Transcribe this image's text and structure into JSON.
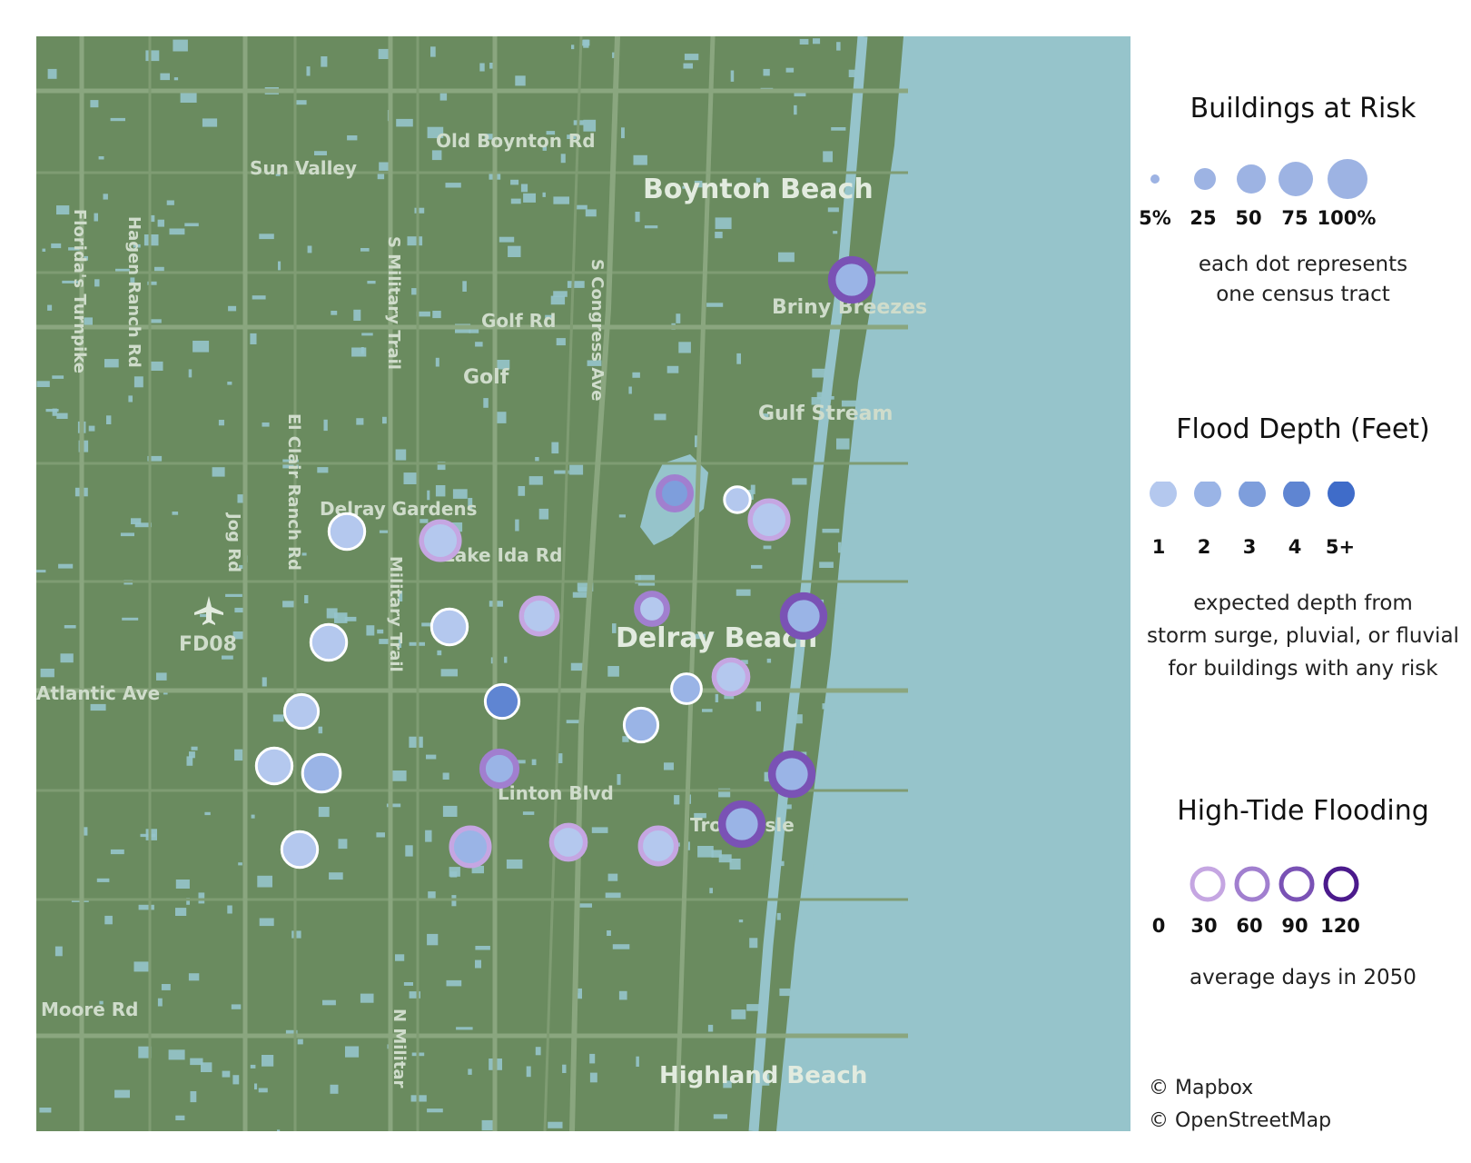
{
  "map": {
    "colors": {
      "land": "#6a8b5f",
      "water": "#96c4cb",
      "road": "#7f9c73",
      "major_road": "#8aa67f"
    },
    "labels": [
      {
        "text": "Old Boynton Rd",
        "kind": "road"
      },
      {
        "text": "Sun Valley",
        "kind": "place"
      },
      {
        "text": "Boynton Beach",
        "kind": "city"
      },
      {
        "text": "Briny Breezes",
        "kind": "place"
      },
      {
        "text": "Golf Rd",
        "kind": "road"
      },
      {
        "text": "Golf",
        "kind": "place"
      },
      {
        "text": "Gulf Stream",
        "kind": "place"
      },
      {
        "text": "Delray Gardens",
        "kind": "place"
      },
      {
        "text": "Lake Ida Rd",
        "kind": "road"
      },
      {
        "text": "Delray Beach",
        "kind": "city"
      },
      {
        "text": "FD08",
        "kind": "airport"
      },
      {
        "text": "Atlantic Ave",
        "kind": "road"
      },
      {
        "text": "Linton Blvd",
        "kind": "road"
      },
      {
        "text": "Tropic Isle",
        "kind": "place"
      },
      {
        "text": "Moore Rd",
        "kind": "road"
      },
      {
        "text": "Highland Beach",
        "kind": "city"
      },
      {
        "text": "Florida's Turnpike",
        "kind": "road"
      },
      {
        "text": "Hagen Ranch Rd",
        "kind": "road"
      },
      {
        "text": "S Military Trail",
        "kind": "road"
      },
      {
        "text": "S Congress Ave",
        "kind": "road"
      },
      {
        "text": "Military Trail",
        "kind": "road"
      },
      {
        "text": "Jog Rd",
        "kind": "road"
      },
      {
        "text": "El Clair Ranch Rd",
        "kind": "road"
      },
      {
        "text": "N Militar",
        "kind": "road"
      }
    ],
    "tracts": [
      {
        "depth": 2,
        "risk": 45,
        "tide_days": 90
      },
      {
        "depth": 3,
        "risk": 25,
        "tide_days": 60
      },
      {
        "depth": 1,
        "risk": 10,
        "tide_days": 0
      },
      {
        "depth": 1,
        "risk": 40,
        "tide_days": 30
      },
      {
        "depth": 1,
        "risk": 35,
        "tide_days": 0
      },
      {
        "depth": 1,
        "risk": 40,
        "tide_days": 30
      },
      {
        "depth": 1,
        "risk": 35,
        "tide_days": 30
      },
      {
        "depth": 1,
        "risk": 20,
        "tide_days": 60
      },
      {
        "depth": 2,
        "risk": 45,
        "tide_days": 90
      },
      {
        "depth": 1,
        "risk": 35,
        "tide_days": 0
      },
      {
        "depth": 1,
        "risk": 35,
        "tide_days": 0
      },
      {
        "depth": 1,
        "risk": 30,
        "tide_days": 30
      },
      {
        "depth": 2,
        "risk": 20,
        "tide_days": 0
      },
      {
        "depth": 4,
        "risk": 30,
        "tide_days": 0
      },
      {
        "depth": 1,
        "risk": 30,
        "tide_days": 0
      },
      {
        "depth": 2,
        "risk": 30,
        "tide_days": 0
      },
      {
        "depth": 1,
        "risk": 35,
        "tide_days": 0
      },
      {
        "depth": 2,
        "risk": 40,
        "tide_days": 0
      },
      {
        "depth": 2,
        "risk": 30,
        "tide_days": 60
      },
      {
        "depth": 2,
        "risk": 45,
        "tide_days": 90
      },
      {
        "depth": 1,
        "risk": 35,
        "tide_days": 0
      },
      {
        "depth": 2,
        "risk": 40,
        "tide_days": 30
      },
      {
        "depth": 1,
        "risk": 30,
        "tide_days": 30
      },
      {
        "depth": 1,
        "risk": 35,
        "tide_days": 30
      },
      {
        "depth": 2,
        "risk": 45,
        "tide_days": 90
      }
    ]
  },
  "legend": {
    "risk": {
      "title": "Buildings at Risk",
      "labels": [
        "5%",
        "25",
        "50",
        "75",
        "100%"
      ],
      "desc_line1": "each dot represents",
      "desc_line2": "one census tract",
      "color": "#9db3e3"
    },
    "depth": {
      "title": "Flood Depth (Feet)",
      "labels": [
        "1",
        "2",
        "3",
        "4",
        "5+"
      ],
      "colors": [
        "#b4c8ee",
        "#9ab4e6",
        "#7e9edc",
        "#5f85d2",
        "#3f6cc9"
      ],
      "desc_line1": "expected depth from",
      "desc_line2": "storm surge, pluvial, or fluvial",
      "desc_line3": "for buildings with any risk"
    },
    "tide": {
      "title": "High-Tide Flooding",
      "labels": [
        "0",
        "30",
        "60",
        "90",
        "120"
      ],
      "colors": [
        "#ffffff",
        "#c5a6e2",
        "#a17fcf",
        "#7a52b5",
        "#4b1a8c"
      ],
      "desc": "average days in 2050"
    }
  },
  "credits": {
    "line1": "© Mapbox",
    "line2": "© OpenStreetMap"
  }
}
